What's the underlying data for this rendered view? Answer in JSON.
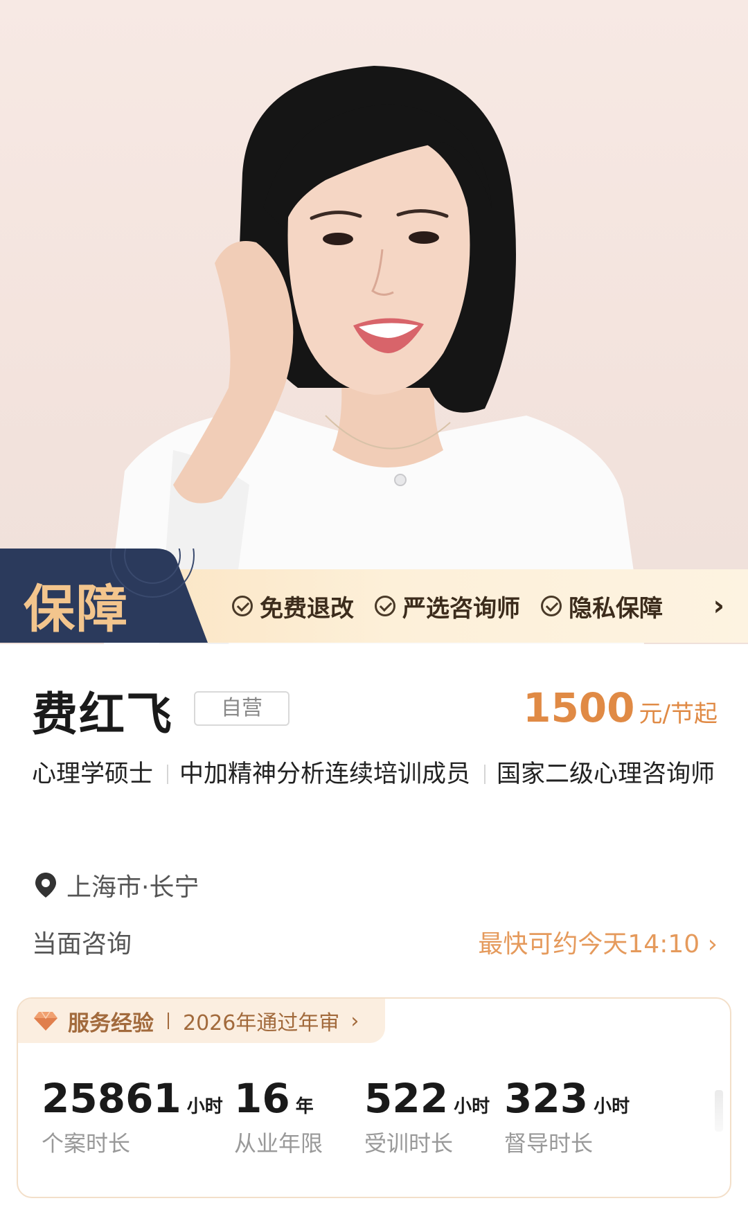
{
  "guarantee": {
    "title": "保障",
    "items": [
      "免费退改",
      "严选咨询师",
      "隐私保障"
    ]
  },
  "profile": {
    "name": "费红飞",
    "badge": "自营",
    "price": "1500",
    "price_unit": "元/节起",
    "credentials": [
      "心理学硕士",
      "中加精神分析连续培训成员",
      "国家二级心理咨询师"
    ],
    "location": "上海市·长宁",
    "consult_type": "当面咨询",
    "earliest": "最快可约今天14:10"
  },
  "service": {
    "label": "服务经验",
    "audit": "2026年通过年审",
    "stats": [
      {
        "value": "25861",
        "unit": "小时",
        "label": "个案时长"
      },
      {
        "value": "16",
        "unit": "年",
        "label": "从业年限"
      },
      {
        "value": "522",
        "unit": "小时",
        "label": "受训时长"
      },
      {
        "value": "323",
        "unit": "小时",
        "label": "督导时长"
      }
    ]
  },
  "colors": {
    "accent": "#e08a45",
    "navy": "#2b3a5c",
    "gold": "#f3c58d",
    "service_text": "#a26a3c"
  },
  "icons": {
    "check": "check-circle-icon",
    "pin": "location-pin-icon",
    "diamond": "diamond-icon",
    "chevron": "chevron-right-icon"
  }
}
